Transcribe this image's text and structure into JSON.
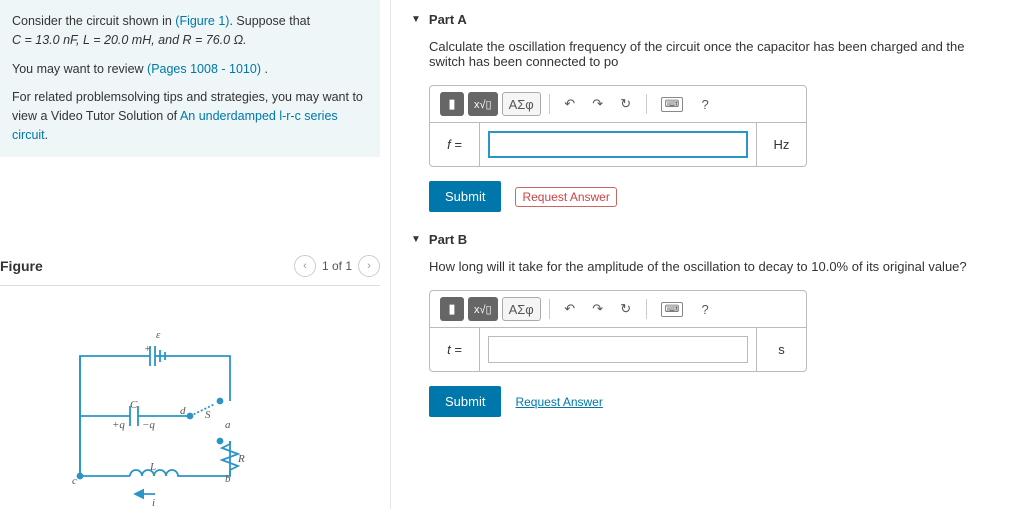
{
  "problem": {
    "intro": "Consider the circuit shown in ",
    "figure_link": "(Figure 1)",
    "intro2": ". Suppose that ",
    "params_html": "C = 13.0 nF, L = 20.0 mH, and R = 76.0 Ω.",
    "review_pre": "You may want to review ",
    "review_link": "(Pages 1008 - 1010)",
    "review_post": " .",
    "tips_pre": "For related problemsolving tips and strategies, you may want to view a Video Tutor Solution of ",
    "tips_link": "An underdamped l-r-c series circuit",
    "tips_post": "."
  },
  "figure": {
    "title": "Figure",
    "pager": "1 of 1"
  },
  "partA": {
    "title": "Part A",
    "desc": "Calculate the oscillation frequency of the circuit once the capacitor has been charged and the switch has been connected to po",
    "var": "f =",
    "unit": "Hz",
    "submit": "Submit",
    "request": "Request Answer"
  },
  "partB": {
    "title": "Part B",
    "desc": "How long will it take for the amplitude of the oscillation to decay to 10.0% of its original value?",
    "var": "t =",
    "unit": "s",
    "submit": "Submit",
    "request": "Request Answer"
  },
  "toolbar": {
    "greek": "ΑΣφ",
    "help": "?"
  }
}
